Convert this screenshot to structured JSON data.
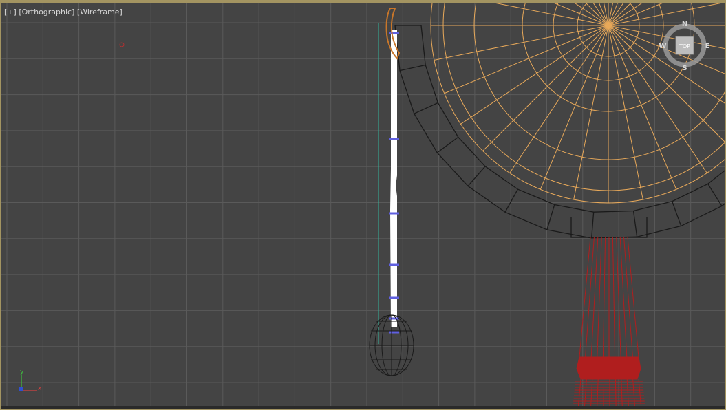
{
  "viewport": {
    "label_plus": "[+]",
    "label_view": "[Orthographic]",
    "label_shading": "[Wireframe]"
  },
  "view_cube": {
    "face_label": "TOP",
    "north": "N",
    "south": "S",
    "east": "E",
    "west": "W"
  },
  "axis_gizmo": {
    "y_label": "y",
    "x_label": "x"
  },
  "colors": {
    "background": "#444444",
    "grid": "#5a5a5a",
    "border_active": "#a39461",
    "selected_wire": "#e8a95a",
    "black_wire": "#1a1a1a",
    "red_wire": "#b01e1e",
    "white_object": "#ffffff",
    "vertex_tick": "#6060e0",
    "teal_line": "#35b49c"
  }
}
